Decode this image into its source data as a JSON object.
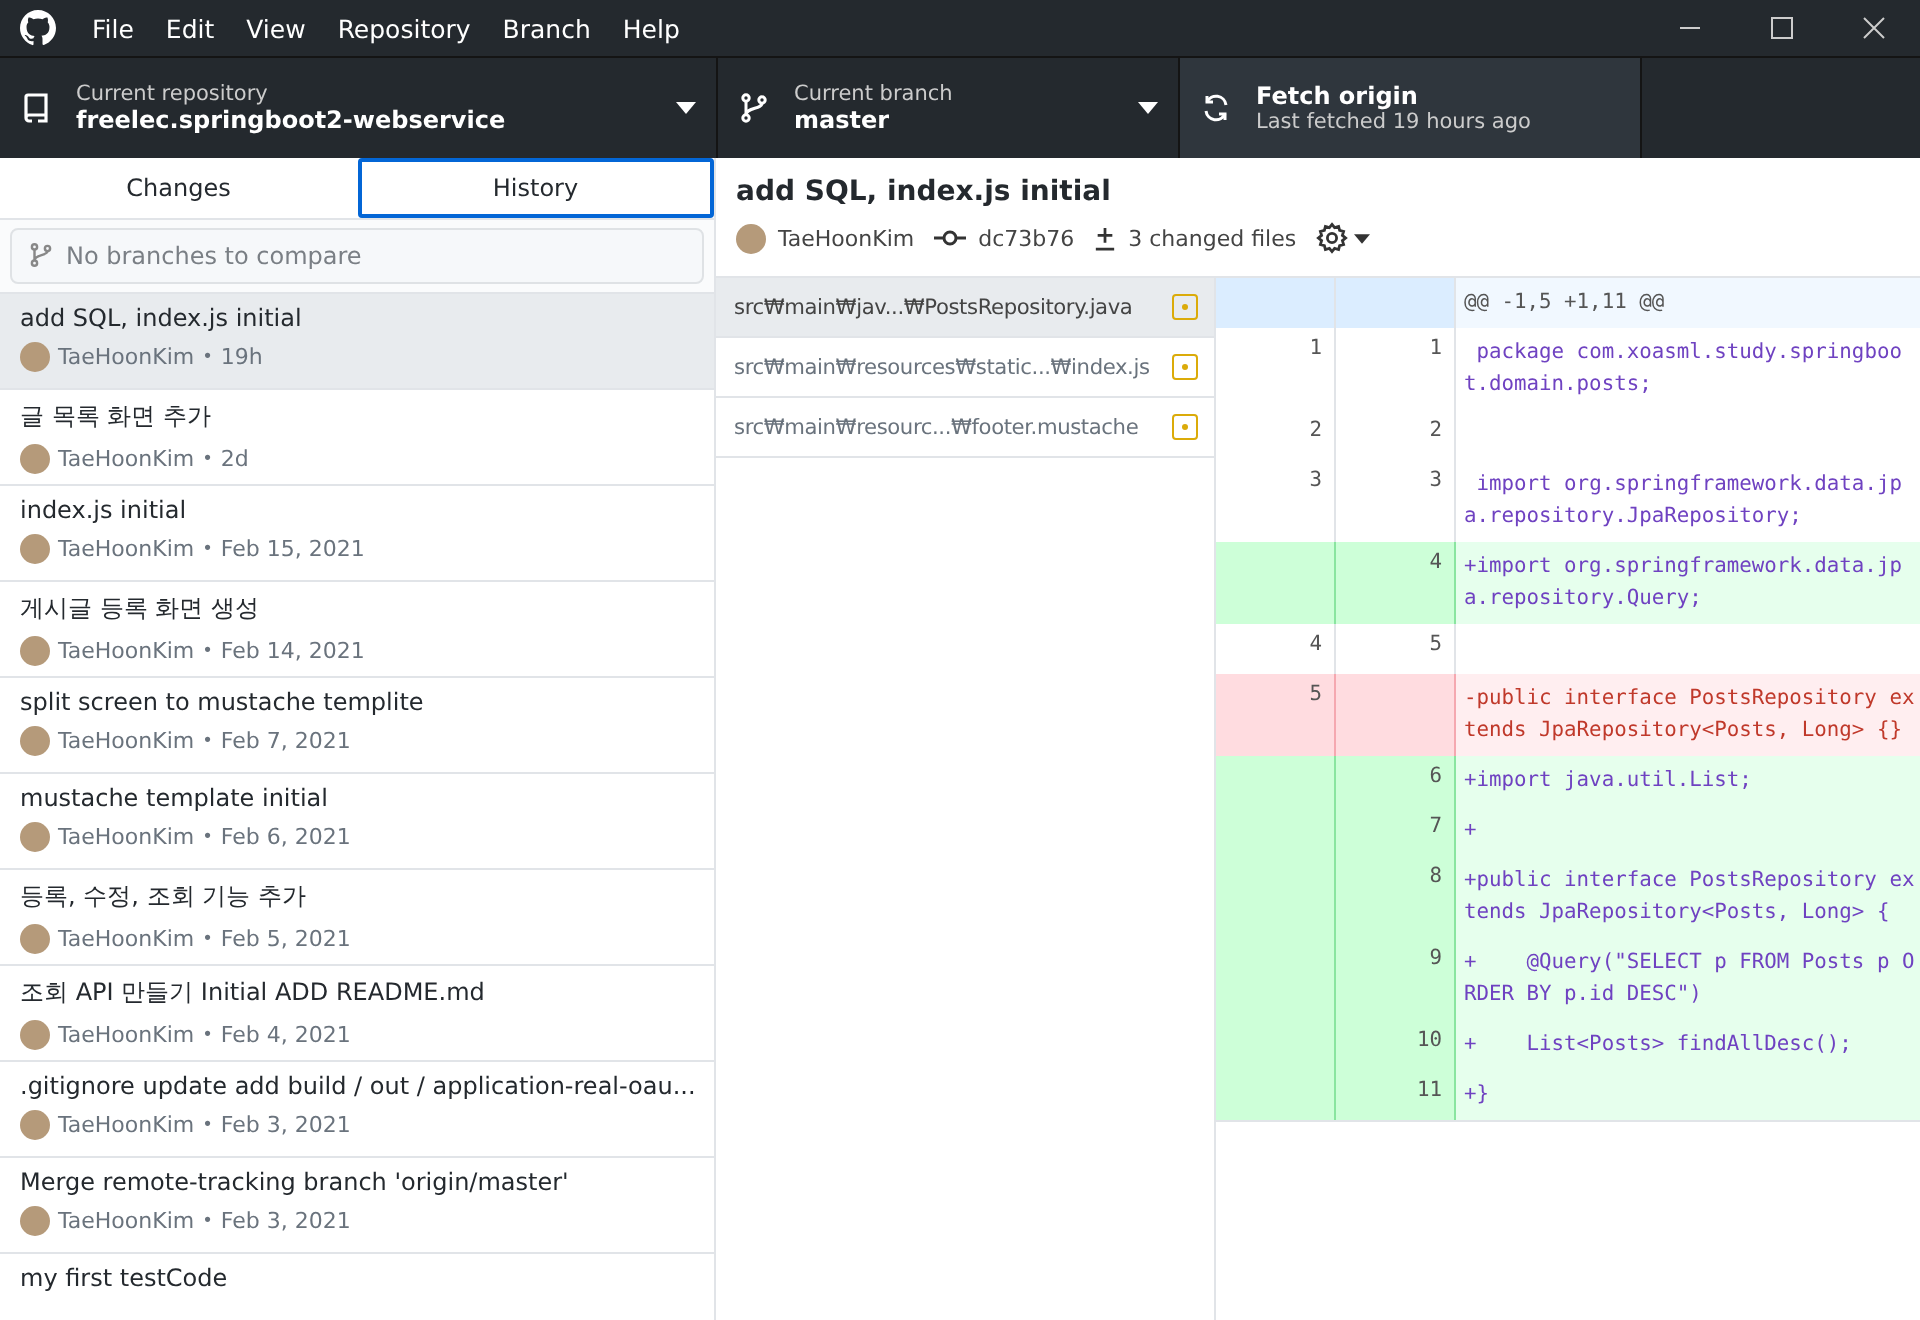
{
  "menu": [
    "File",
    "Edit",
    "View",
    "Repository",
    "Branch",
    "Help"
  ],
  "toolbar": {
    "repository": {
      "label": "Current repository",
      "value": "freelec.springboot2-webservice"
    },
    "branch": {
      "label": "Current branch",
      "value": "master"
    },
    "fetch": {
      "label": "Fetch origin",
      "detail": "Last fetched 19 hours ago"
    }
  },
  "tabs": [
    {
      "label": "Changes",
      "selected": false
    },
    {
      "label": "History",
      "selected": true
    }
  ],
  "branch_filter": {
    "placeholder": "No branches to compare"
  },
  "commits": [
    {
      "title": "add SQL, index.js initial",
      "author": "TaeHoonKim",
      "separator": "•",
      "time": "19h",
      "selected": true
    },
    {
      "title": "글 목록 화면 추가",
      "author": "TaeHoonKim",
      "separator": "•",
      "time": "2d",
      "selected": false
    },
    {
      "title": "index.js initial",
      "author": "TaeHoonKim",
      "separator": "•",
      "time": "Feb 15, 2021",
      "selected": false
    },
    {
      "title": "게시글 등록 화면 생성",
      "author": "TaeHoonKim",
      "separator": "•",
      "time": "Feb 14, 2021",
      "selected": false
    },
    {
      "title": "split screen to mustache templite",
      "author": "TaeHoonKim",
      "separator": "•",
      "time": "Feb 7, 2021",
      "selected": false
    },
    {
      "title": "mustache template initial",
      "author": "TaeHoonKim",
      "separator": "•",
      "time": "Feb 6, 2021",
      "selected": false
    },
    {
      "title": "등록, 수정, 조회 기능 추가",
      "author": "TaeHoonKim",
      "separator": "•",
      "time": "Feb 5, 2021",
      "selected": false
    },
    {
      "title": "조회 API 만들기 Initial ADD README.md",
      "author": "TaeHoonKim",
      "separator": "•",
      "time": "Feb 4, 2021",
      "selected": false
    },
    {
      "title": ".gitignore update add build / out / application-real-oau...",
      "author": "TaeHoonKim",
      "separator": "•",
      "time": "Feb 3, 2021",
      "selected": false
    },
    {
      "title": "Merge remote-tracking branch 'origin/master'",
      "author": "TaeHoonKim",
      "separator": "•",
      "time": "Feb 3, 2021",
      "selected": false
    },
    {
      "title": "my first testCode",
      "selected": false
    }
  ],
  "commit_detail": {
    "title": "add SQL, index.js initial",
    "author": "TaeHoonKim",
    "sha": "dc73b76",
    "changed_files": "3 changed files"
  },
  "files": [
    {
      "path": "src₩main₩jav...₩PostsRepository.java",
      "selected": true
    },
    {
      "path": "src₩main₩resources₩static...₩index.js",
      "selected": false
    },
    {
      "path": "src₩main₩resourc...₩footer.mustache",
      "selected": false
    }
  ],
  "diff": [
    {
      "kind": "hunk",
      "text": "@@ -1,5 +1,11 @@"
    },
    {
      "kind": "context",
      "old": "1",
      "new": "1",
      "text": " package com.xoasml.study.springboot.domain.posts;"
    },
    {
      "kind": "context",
      "old": "2",
      "new": "2"
    },
    {
      "kind": "context",
      "old": "3",
      "new": "3",
      "text": " import org.springframework.data.jpa.repository.JpaRepository;"
    },
    {
      "kind": "add",
      "new": "4",
      "text": "+import org.springframework.data.jpa.repository.Query;"
    },
    {
      "kind": "context",
      "old": "4",
      "new": "5"
    },
    {
      "kind": "del",
      "old": "5",
      "text": "-public interface PostsRepository extends JpaRepository<Posts, Long> {}"
    },
    {
      "kind": "add",
      "new": "6",
      "text": "+import java.util.List;"
    },
    {
      "kind": "add",
      "new": "7",
      "text": "+"
    },
    {
      "kind": "add",
      "new": "8",
      "text": "+public interface PostsRepository extends JpaRepository<Posts, Long> {"
    },
    {
      "kind": "add",
      "new": "9",
      "text": "+    @Query(\"SELECT p FROM Posts p ORDER BY p.id DESC\")"
    },
    {
      "kind": "add",
      "new": "10",
      "text": "+    List<Posts> findAllDesc();"
    },
    {
      "kind": "add",
      "new": "11",
      "text": "+}"
    }
  ]
}
